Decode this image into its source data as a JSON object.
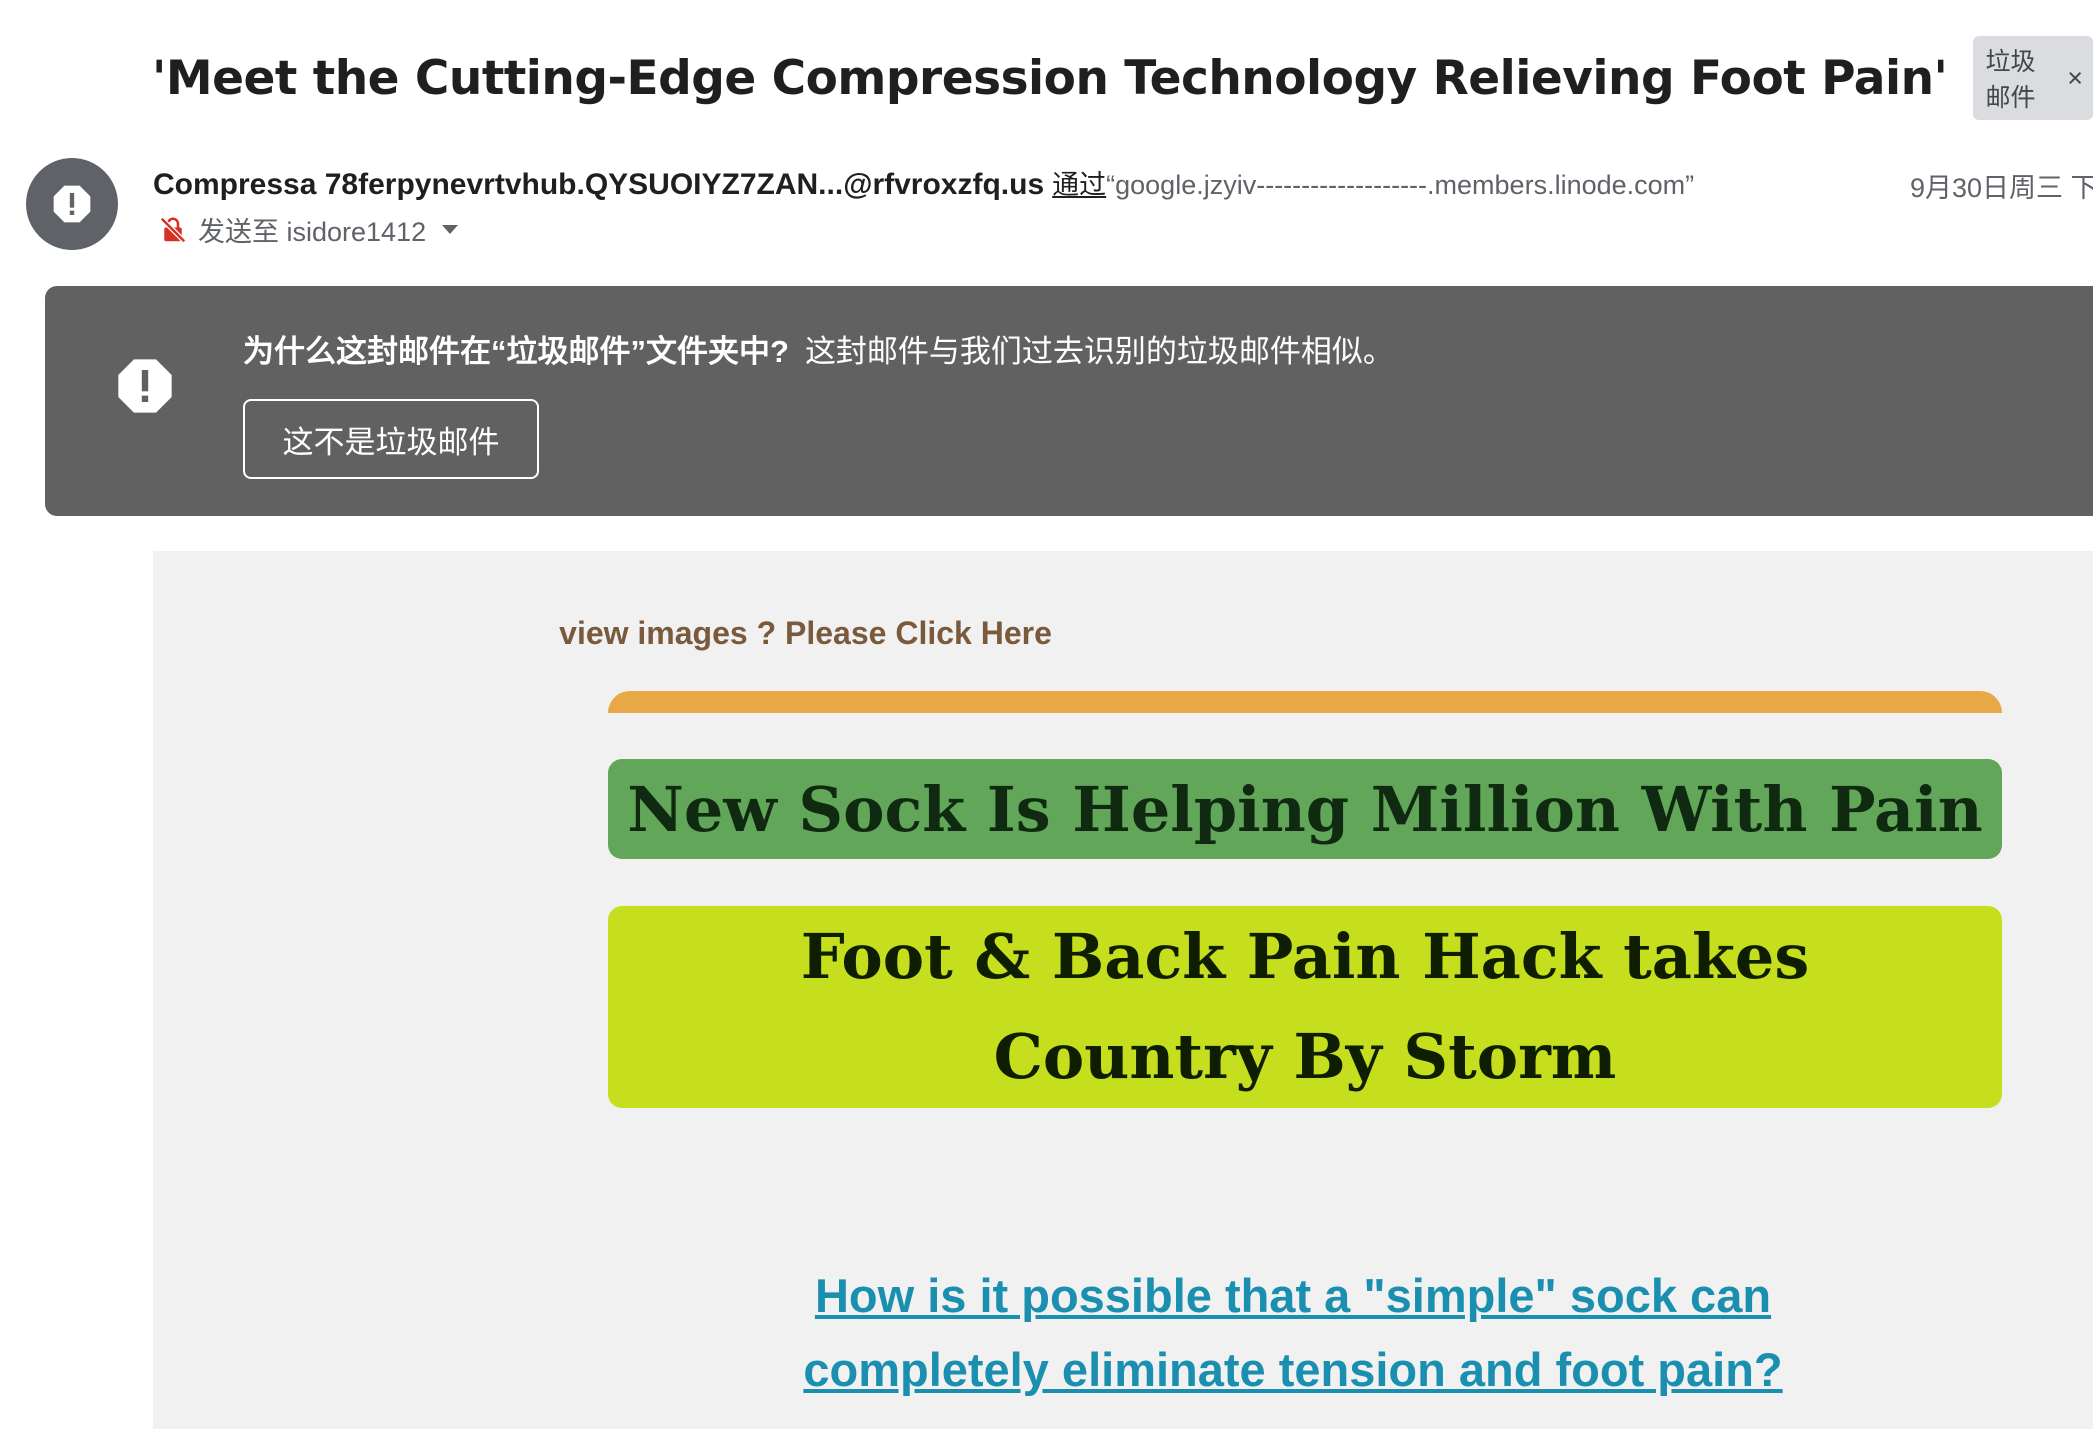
{
  "subject": {
    "title": "'Meet the Cutting-Edge Compression Technology Relieving Foot Pain'",
    "label_chip": "垃圾邮件",
    "chip_close": "×"
  },
  "sender": {
    "avatar_icon": "alert-octagon-icon",
    "name": "Compressa 78ferpynevrtvhub.QYSUOIYZ7ZAN...@rfvroxzfq.us",
    "via_label": "通过",
    "via_domain": "“google.jzyiv-------------------.members.linode.com”",
    "date": "9月30日周三 下",
    "to_icon": "unsecure-lock-icon",
    "to_text": "发送至 isidore1412"
  },
  "spam_banner": {
    "icon": "alert-octagon-icon",
    "question": "为什么这封邮件在“垃圾邮件”文件夹中?",
    "explanation": "这封邮件与我们过去识别的垃圾邮件相似。",
    "not_spam_button": "这不是垃圾邮件"
  },
  "email_body": {
    "view_images": "view images ? Please Click Here",
    "headline1": "New Sock Is Helping Million With Pain",
    "headline2": "Foot & Back Pain Hack takes Country By Storm",
    "question_link": "How is it possible that a \"simple\" sock can completely eliminate tension and foot pain?"
  },
  "colors": {
    "banner_bg": "#616161",
    "orange_bar": "#e8a845",
    "green_box": "#62a65a",
    "lime_box": "#c5df1f",
    "link": "#1b8fb0",
    "view_images_text": "#7a5a3c"
  }
}
